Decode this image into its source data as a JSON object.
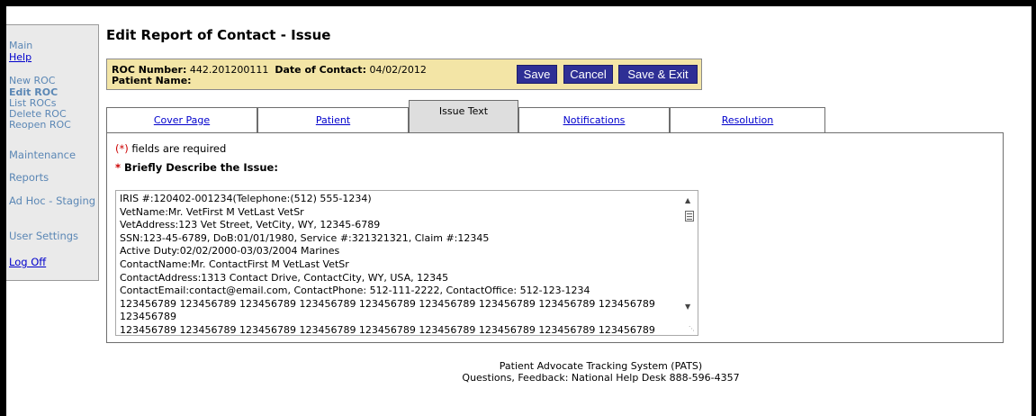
{
  "sidebar": {
    "items": [
      {
        "label": "Main",
        "kind": "plain"
      },
      {
        "label": "Help",
        "kind": "link"
      },
      {
        "label": "New ROC",
        "kind": "plain"
      },
      {
        "label": "Edit ROC",
        "kind": "active"
      },
      {
        "label": "List ROCs",
        "kind": "plain"
      },
      {
        "label": "Delete ROC",
        "kind": "plain"
      },
      {
        "label": "Reopen ROC",
        "kind": "plain"
      },
      {
        "label": "Maintenance",
        "kind": "plain"
      },
      {
        "label": "Reports",
        "kind": "plain"
      },
      {
        "label": "Ad Hoc - Staging",
        "kind": "plain"
      },
      {
        "label": "User Settings",
        "kind": "plain"
      },
      {
        "label": "Log Off",
        "kind": "link"
      }
    ]
  },
  "page": {
    "title": "Edit Report of Contact - Issue"
  },
  "infobar": {
    "roc_label": "ROC Number:",
    "roc_value": "442.201200111",
    "date_label": "Date of Contact:",
    "date_value": "04/02/2012",
    "patient_label": "Patient Name:",
    "save_label": "Save",
    "cancel_label": "Cancel",
    "save_exit_label": "Save & Exit"
  },
  "tabs": [
    {
      "label": "Cover Page",
      "active": false
    },
    {
      "label": "Patient",
      "active": false
    },
    {
      "label": "Issue Text",
      "active": true
    },
    {
      "label": "Notifications",
      "active": false
    },
    {
      "label": "Resolution",
      "active": false
    }
  ],
  "form": {
    "required_marker": "(*)",
    "required_note": " fields are required",
    "describe_star": "*",
    "describe_label": " Briefly Describe the Issue:",
    "issue_lines": [
      "IRIS #:120402-001234(Telephone:(512) 555-1234)",
      "VetName:Mr. VetFirst M VetLast VetSr",
      "VetAddress:123 Vet Street, VetCity, WY, 12345-6789",
      "SSN:123-45-6789, DoB:01/01/1980, Service #:321321321, Claim #:12345",
      "Active Duty:02/02/2000-03/03/2004 Marines",
      "ContactName:Mr. ContactFirst M VetLast VetSr",
      "ContactAddress:1313 Contact Drive, ContactCity, WY, USA, 12345",
      "ContactEmail:contact@email.com, ContactPhone: 512-111-2222, ContactOffice: 512-123-1234",
      "123456789 123456789 123456789 123456789 123456789 123456789 123456789 123456789 123456789 123456789",
      "123456789 123456789 123456789 123456789 123456789 123456789 123456789 123456789 123456789 123456789"
    ]
  },
  "footer": {
    "line1": "Patient Advocate Tracking System (PATS)",
    "line2": "Questions, Feedback: National Help Desk   888-596-4357"
  }
}
